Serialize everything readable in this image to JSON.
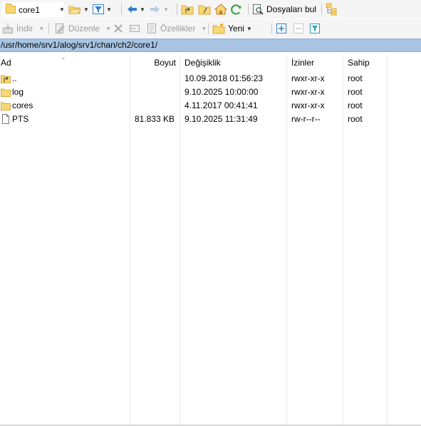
{
  "toolbar1": {
    "folder_combo": "core1",
    "find_files_label": "Dosyaları bul"
  },
  "toolbar2": {
    "download_label": "İndir",
    "edit_label": "Düzenle",
    "properties_label": "Özellikler",
    "new_label": "Yeni"
  },
  "path": "/usr/home/srv1/alog/srv1/chan/ch2/core1/",
  "columns": {
    "name": "Ad",
    "size": "Boyut",
    "modified": "Değişiklik",
    "permissions": "İzinler",
    "owner": "Sahip"
  },
  "rows": [
    {
      "name": "..",
      "size": "",
      "modified": "10.09.2018 01:56:23",
      "permissions": "rwxr-xr-x",
      "owner": "root",
      "icon": "parent-folder-icon"
    },
    {
      "name": "log",
      "size": "",
      "modified": "9.10.2025 10:00:00",
      "permissions": "rwxr-xr-x",
      "owner": "root",
      "icon": "folder-icon"
    },
    {
      "name": "cores",
      "size": "",
      "modified": "4.11.2017 00:41:41",
      "permissions": "rwxr-xr-x",
      "owner": "root",
      "icon": "folder-icon"
    },
    {
      "name": "PTS",
      "size": "81.833 KB",
      "modified": "9.10.2025 11:31:49",
      "permissions": "rw-r--r--",
      "owner": "root",
      "icon": "file-icon"
    }
  ],
  "colors": {
    "path_bar": "#a9c4e3",
    "folder": "#f8d775",
    "accent_blue": "#2f7fd0",
    "refresh_green": "#3aa04a"
  }
}
